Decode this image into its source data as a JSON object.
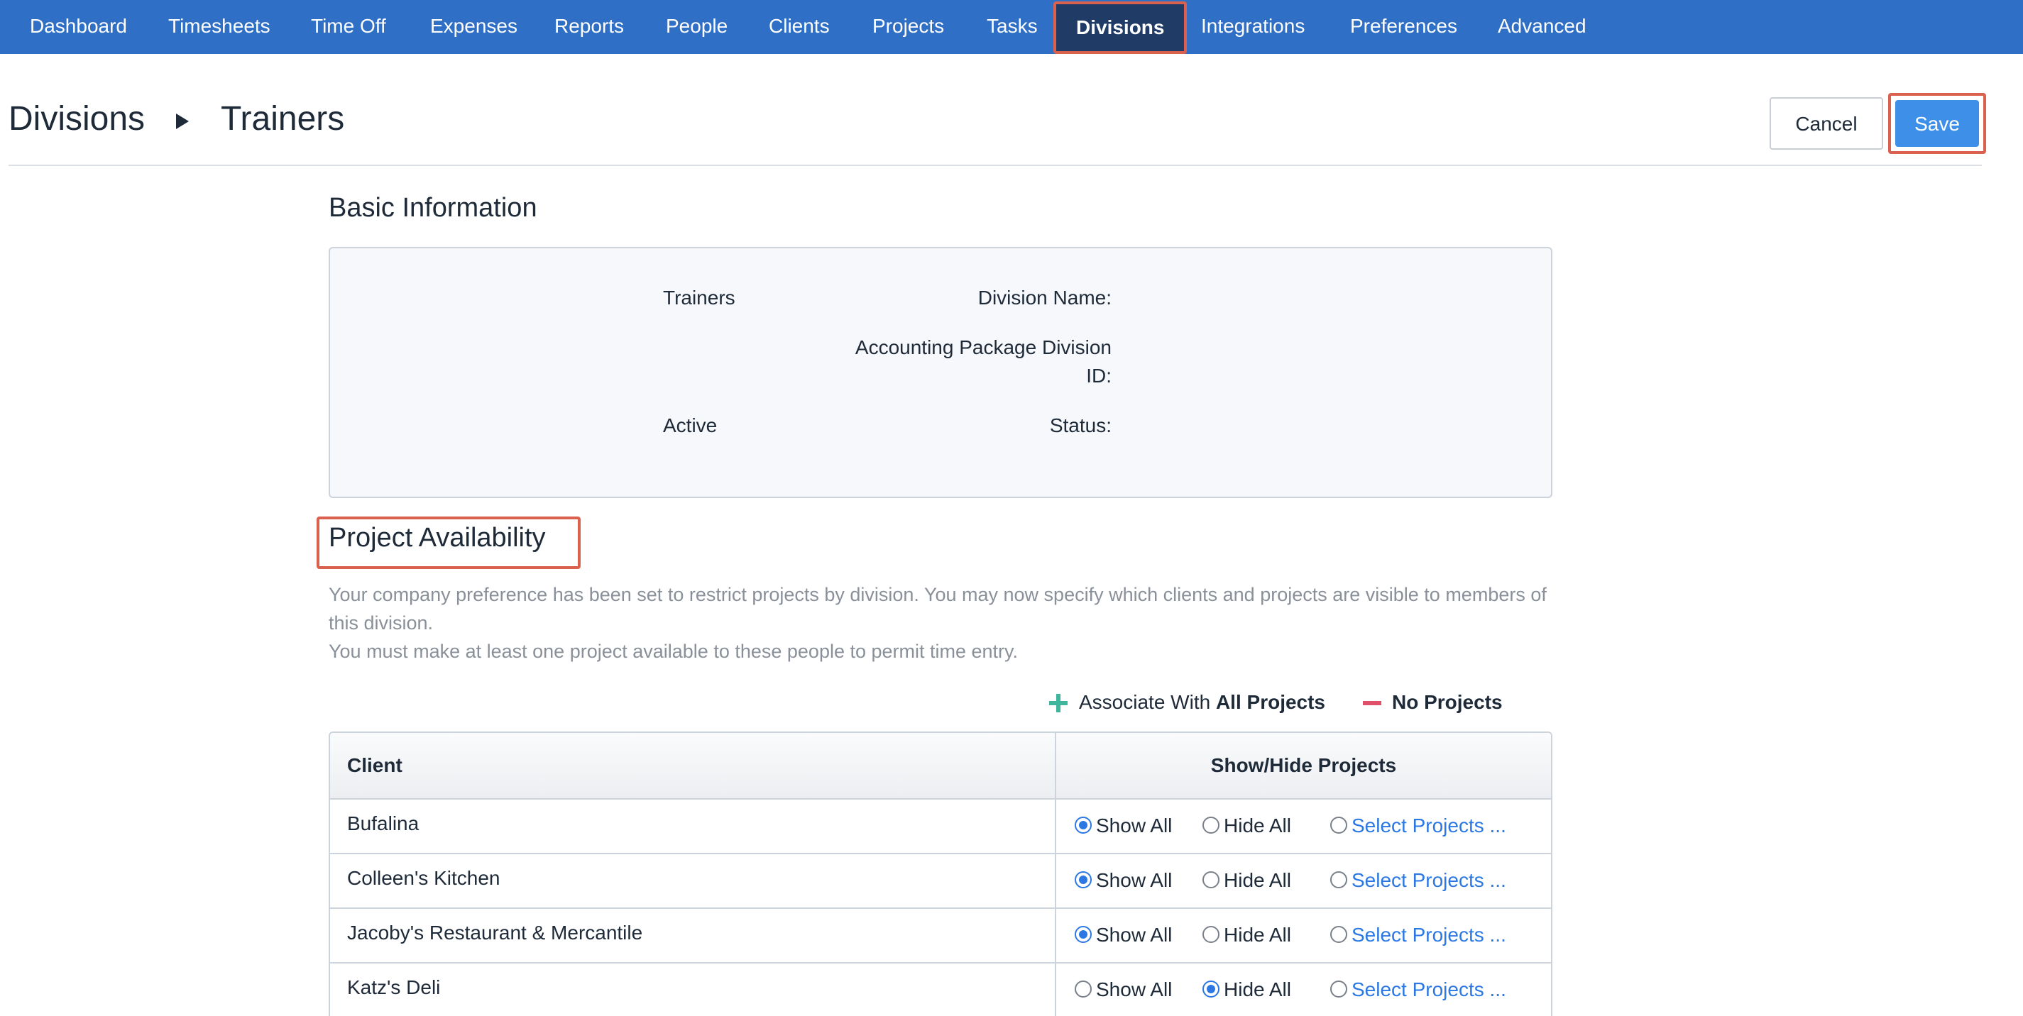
{
  "nav": {
    "items": [
      {
        "label": "Dashboard",
        "active": false
      },
      {
        "label": "Timesheets",
        "active": false
      },
      {
        "label": "Time Off",
        "active": false
      },
      {
        "label": "Expenses",
        "active": false
      },
      {
        "label": "Reports",
        "active": false
      },
      {
        "label": "People",
        "active": false
      },
      {
        "label": "Clients",
        "active": false
      },
      {
        "label": "Projects",
        "active": false
      },
      {
        "label": "Tasks",
        "active": false
      },
      {
        "label": "Divisions",
        "active": true
      },
      {
        "label": "Integrations",
        "active": false
      },
      {
        "label": "Preferences",
        "active": false
      },
      {
        "label": "Advanced",
        "active": false
      }
    ]
  },
  "header": {
    "breadcrumb_root": "Divisions",
    "breadcrumb_current": "Trainers",
    "cancel_label": "Cancel",
    "save_label": "Save"
  },
  "basic_info": {
    "title": "Basic Information",
    "fields": {
      "name_label": "Division Name:",
      "name_value": "Trainers",
      "acct_label_line1": "Accounting Package Division",
      "acct_label_line2": "ID:",
      "acct_value": "",
      "status_label": "Status:",
      "status_value": "Active"
    }
  },
  "project_availability": {
    "title": "Project Availability",
    "help_line1": "Your company preference has been set to restrict projects by division. You may now specify which clients and projects are visible to members of this division.",
    "help_line2": "You must make at least one project available to these people to permit time entry.",
    "associate_prefix": "Associate With ",
    "associate_bold": "All Projects",
    "no_projects_label": "No Projects"
  },
  "table": {
    "col_client": "Client",
    "col_show_hide": "Show/Hide Projects",
    "option_show_all": "Show All",
    "option_hide_all": "Hide All",
    "option_select": "Select Projects ...",
    "rows": [
      {
        "client": "Bufalina",
        "selected": "show"
      },
      {
        "client": "Colleen's Kitchen",
        "selected": "show"
      },
      {
        "client": "Jacoby's Restaurant & Mercantile",
        "selected": "show"
      },
      {
        "client": "Katz's Deli",
        "selected": "hide"
      }
    ]
  },
  "colors": {
    "nav_bg": "#2f6fc5",
    "nav_active_bg": "#1f3b66",
    "highlight": "#d9614d",
    "save_bg": "#3d8fe8",
    "link": "#2b78e4",
    "plus": "#3fb59b",
    "minus": "#e0506b"
  }
}
